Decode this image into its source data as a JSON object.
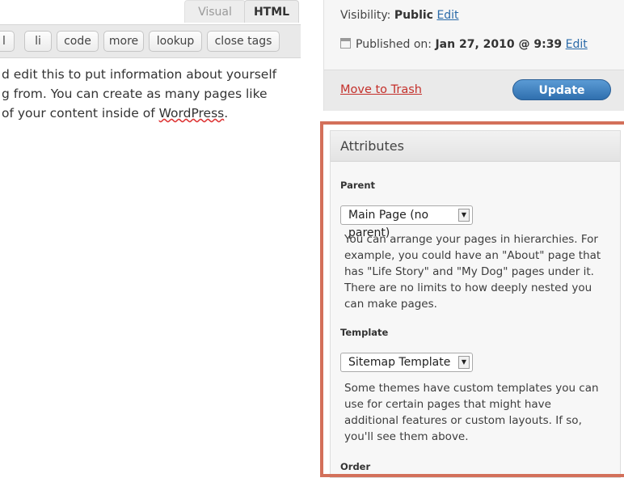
{
  "editor": {
    "tabs": {
      "visual": "Visual",
      "html": "HTML"
    },
    "quicktags": [
      "l",
      "li",
      "code",
      "more",
      "lookup",
      "close tags"
    ],
    "content_lines": [
      "d edit this to put information about yourself",
      "g from. You can create as many pages like",
      "of your content inside of "
    ],
    "content_link_word": "WordPress",
    "content_end": "."
  },
  "publish": {
    "visibility_label": "Visibility:",
    "visibility_value": "Public",
    "visibility_edit": "Edit",
    "published_label": "Published on:",
    "published_value": "Jan 27, 2010 @ 9:39",
    "published_edit": "Edit",
    "trash_label": "Move to Trash",
    "update_label": "Update"
  },
  "attributes": {
    "title": "Attributes",
    "parent_label": "Parent",
    "parent_value": "Main Page (no parent)",
    "parent_help": [
      "You can arrange your pages in hierarchies. For",
      "example, you could have an \"About\" page that",
      "has \"Life Story\" and \"My Dog\" pages under it.",
      "There are no limits to how deeply nested you",
      "can make pages."
    ],
    "template_label": "Template",
    "template_value": "Sitemap Template",
    "template_help": [
      "Some themes have custom templates you can",
      "use for certain pages that might have",
      "additional features or custom layouts. If so,",
      "you'll see them above."
    ],
    "order_label": "Order"
  },
  "colors": {
    "highlight": "#d3705a",
    "link": "#2a6aa8",
    "trash": "#c4302b",
    "update_button": "#3d80c0"
  }
}
